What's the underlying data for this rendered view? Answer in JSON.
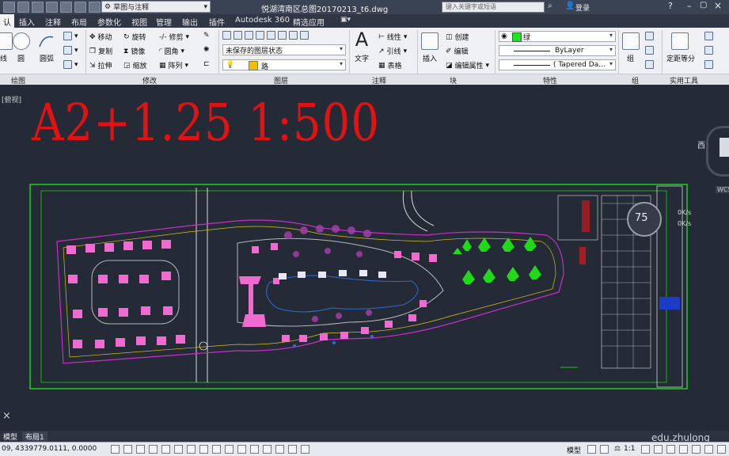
{
  "titlebar": {
    "workspace": "草图与注释",
    "document_title": "悦湖湾南区总图20170213_t6.dwg",
    "search_placeholder": "键入关键字或短语",
    "login": "登录"
  },
  "tabs": [
    {
      "label": "认"
    },
    {
      "label": "插入"
    },
    {
      "label": "注释"
    },
    {
      "label": "布局"
    },
    {
      "label": "参数化"
    },
    {
      "label": "视图"
    },
    {
      "label": "管理"
    },
    {
      "label": "输出"
    },
    {
      "label": "插件"
    },
    {
      "label": "Autodesk 360"
    },
    {
      "label": "精选应用"
    }
  ],
  "ribbon": {
    "draw": {
      "line": "线",
      "circle": "圆",
      "arc": "圆弧"
    },
    "modify": {
      "move": "移动",
      "rotate": "旋转",
      "trim": "修剪",
      "copy": "复制",
      "mirror": "镜像",
      "fillet": "圆角",
      "stretch": "拉伸",
      "scale": "缩放",
      "array": "阵列"
    },
    "layers": {
      "state": "未保存的图层状态",
      "current": "路"
    },
    "annotation": {
      "text": "文字",
      "linear": "线性",
      "leader": "引线",
      "table": "表格"
    },
    "block": {
      "insert": "插入",
      "create": "创建",
      "edit": "编辑",
      "edit_attr": "编辑属性"
    },
    "properties": {
      "color": "绿",
      "linetype": "ByLayer",
      "lineweight": "( Tapered Da..."
    },
    "groups": {
      "group": "组"
    },
    "utilities": {
      "measure": "定距等分"
    }
  },
  "panels": {
    "draw": "绘图",
    "modify": "修改",
    "layers": "图层",
    "annotation": "注释",
    "block": "块",
    "properties": "特性",
    "groups": "组",
    "utilities": "实用工具"
  },
  "canvas": {
    "view_label": "[俯视]",
    "big_text": "A2+1.25 1:500",
    "compass_west": "西",
    "wcs": "WCS",
    "speed_percent": "75",
    "net_up": "0K/s",
    "net_down": "0K/s"
  },
  "layout_tabs": [
    "模型",
    "布局1"
  ],
  "status": {
    "coords": "09, 4339779.0111, 0.0000",
    "model": "模型",
    "scale": "1:1"
  },
  "watermark": "edu.zhulong",
  "colors": {
    "title_bg": "#3a4354",
    "ribbon_bg": "#eef0f3",
    "canvas_bg": "#242a36",
    "big_text": "#e01212",
    "frame": "#19d219",
    "buildings": "#f06ad1",
    "trees": "#21d91b"
  }
}
